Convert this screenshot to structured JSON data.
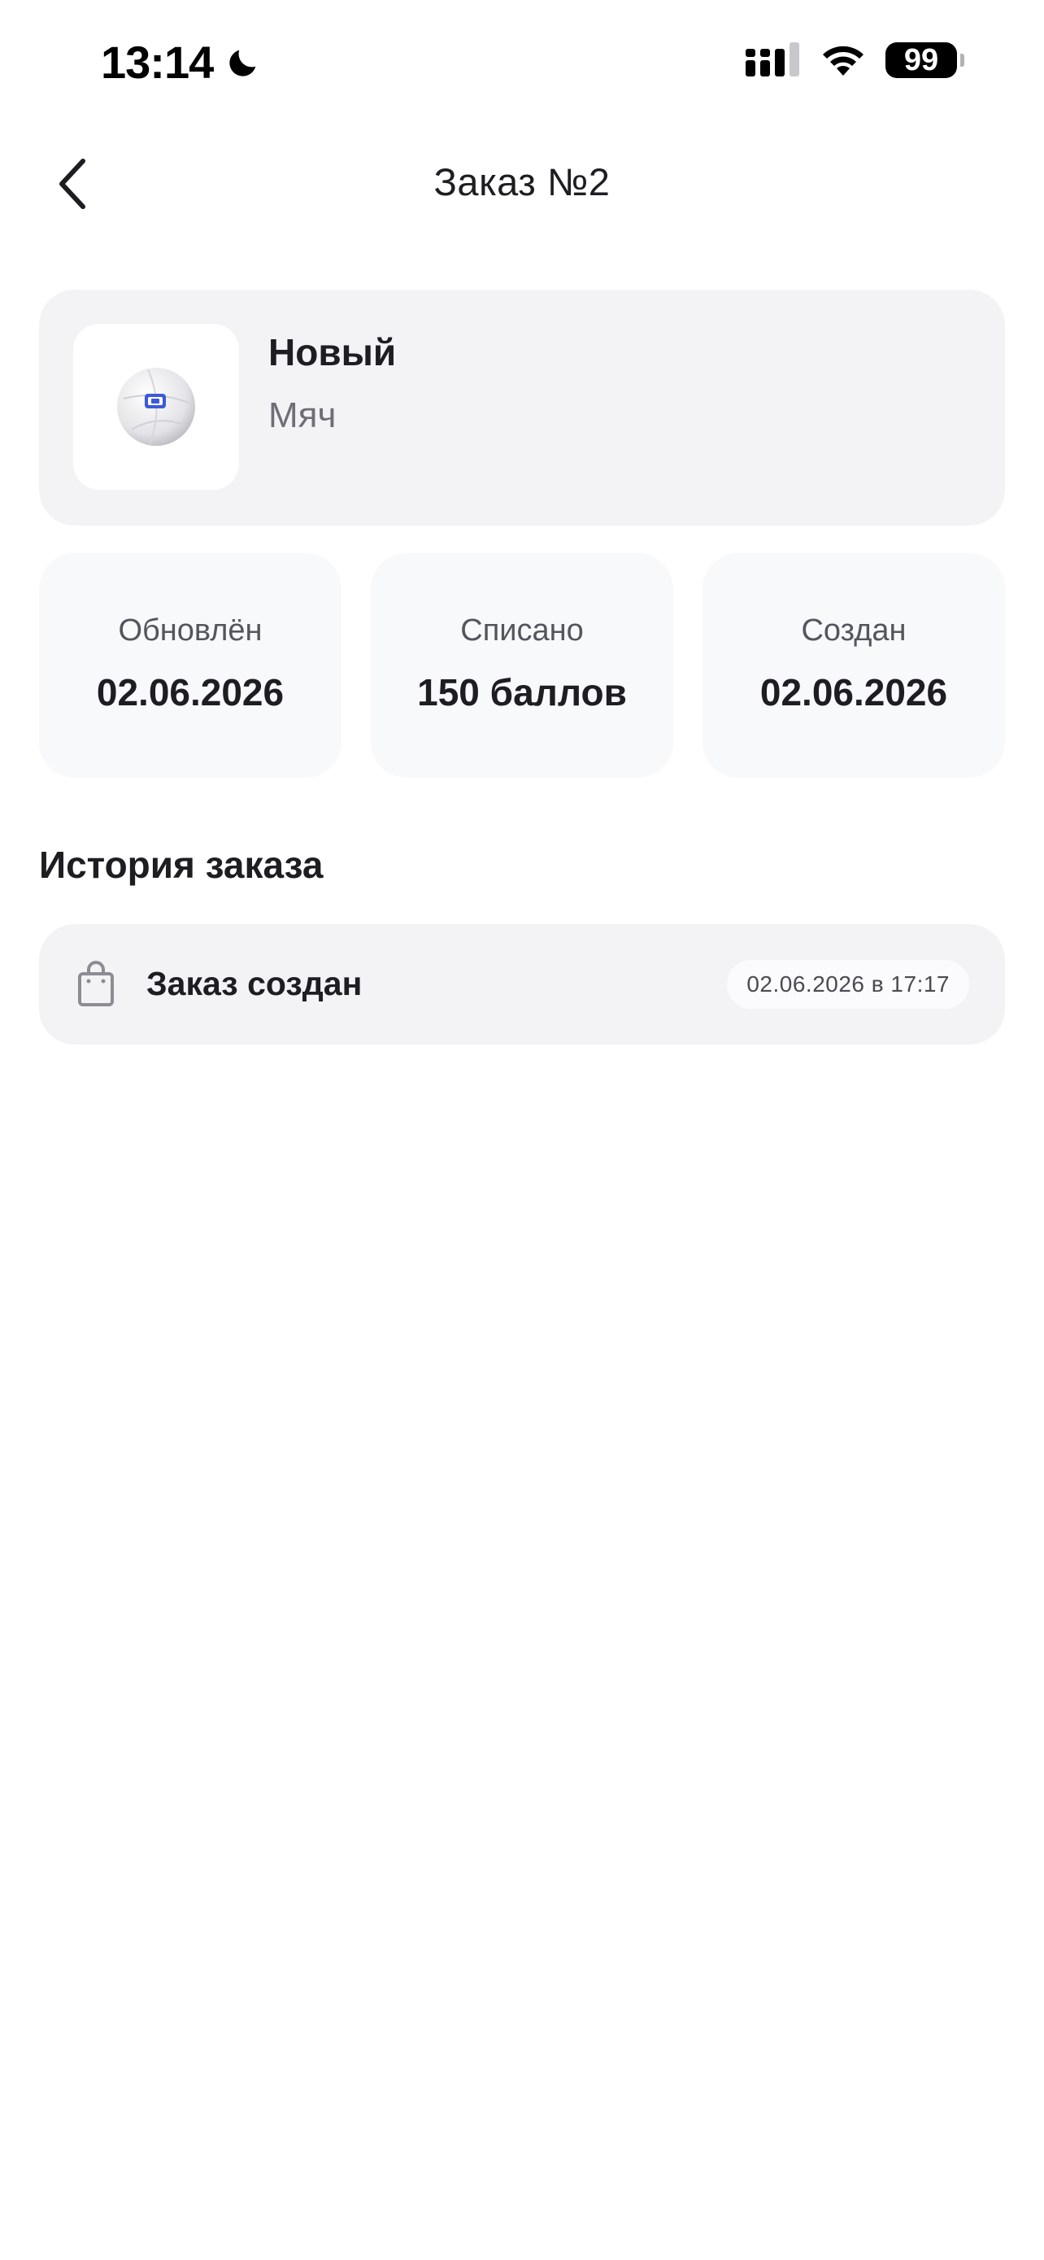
{
  "status_bar": {
    "time": "13:14",
    "battery": "99",
    "icons": [
      "moon-icon",
      "signal-icon",
      "wifi-icon",
      "battery-icon"
    ]
  },
  "nav": {
    "title": "Заказ №2",
    "back_icon": "chevron-left-icon"
  },
  "product": {
    "status": "Новый",
    "name": "Мяч",
    "image_icon": "ball-icon"
  },
  "info": [
    {
      "label": "Обновлён",
      "value": "02.06.2026"
    },
    {
      "label": "Списано",
      "value": "150 баллов"
    },
    {
      "label": "Создан",
      "value": "02.06.2026"
    }
  ],
  "history": {
    "title": "История заказа",
    "items": [
      {
        "icon": "shopping-bag-icon",
        "label": "Заказ создан",
        "date": "02.06.2026 в 17:17"
      }
    ]
  },
  "colors": {
    "card_background": "#f3f3f6",
    "info_background": "#f8f9fb",
    "text_primary": "#1d1d22",
    "text_secondary": "#6e6e78",
    "ball_accent": "#3b5bd9"
  }
}
